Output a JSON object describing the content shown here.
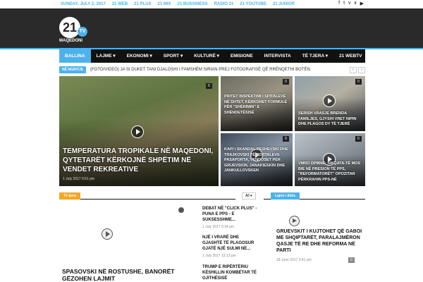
{
  "topbar": {
    "date": "SUNDAY, JULY 2, 2017",
    "links": [
      "21 WEB",
      "21 PLUS",
      "21 MIX",
      "21 BUSSINESS",
      "RADIO 21",
      "21 YOUTUBE",
      "21 JUNIOR"
    ],
    "social_icons": [
      "facebook-icon",
      "twitter-icon",
      "vimeo-icon",
      "vk-icon",
      "youtube-icon"
    ]
  },
  "logo": {
    "number": "21",
    "tv": "TV",
    "sub": "MAQEDONI"
  },
  "nav": {
    "items": [
      "BALLINA",
      "LAJME ▾",
      "EKONOMI ▾",
      "SPORT ▾",
      "KULTURË ▾",
      "EMISIONE",
      "INTERVISTA",
      "TË TJERA ▾",
      "21 WEBTV"
    ],
    "search_icon": "search-icon"
  },
  "ticker": {
    "badge": "NË NGRITJE",
    "text": "(FOTO/VIDEO) JA SI DUKET TANI DJALOSHI I FAMSHËM SIRIAN PREJ FOTOGRAFISË QË RRËNQETHI BOTËN",
    "prev": "‹",
    "next": "›"
  },
  "featured": {
    "main": {
      "title": "TEMPERATURA TROPIKALE NË MAQEDONI, QYTETARËT KËRKOJNË SHPËTIM NË VENDET REKREATIVE",
      "date": "1 July 2017 6:51 pm",
      "comments": "0"
    },
    "tiles": [
      {
        "title": "PRITET INSPEKTIMI I SPITALEVE NË SHTET, KËRKOHET FORMULË PËR \"SHËRIMIN\" E SHËNDETËSISË",
        "comments": "0"
      },
      {
        "title": "SERISH VRASJE BRENDA FAMILJES, GJYSHI VRET NIPIN DHE PLAGOS DY TË TJERË",
        "comments": "0"
      },
      {
        "title": "KAPI I SKANDAL PESHEVSKI DHE TRAJKOVSKI TË PORTALEVE PASAPORTA, VENDOSET PËR GRUEVSKIN, JANAKIESKIN DHE JANKULLOVSKEN",
        "comments": "0"
      },
      {
        "title": "VMRO DPMNE: SIKQATA-TË MOS BIE NË PRESION TË PPS, \"REFORMATORËT\" OPOZITAR PËRKRAHIN PPS-NË",
        "comments": "0"
      }
    ]
  },
  "left_section": {
    "tag": "Të tjera",
    "filter": "All ▾",
    "main_title": "SPASOVSKI NË ROSTUSHE, BANORËT I GËZOHEN LAJMIT"
  },
  "mid_list": [
    {
      "title": "DEBAT NË \"CLICK PLUS\" - PUNA E PPS - E SUKSESSHME...",
      "date": "1 July 2017 5:34 pm"
    },
    {
      "title": "NJË I VRARË DHE GJASHTË TË PLAGOSUR GJATË NJË SULMI NË...",
      "date": "1 July 2017 12:13 pm"
    },
    {
      "title": "TRUMP E RIPËRTËRIU KËSHILLIN KOMBËTAR TË GJITHËSISË",
      "date": ""
    }
  ],
  "right_section": {
    "tag": "Lajmi i ditës",
    "title": "GRUEVSKIT I KUJTOHET QË GABOI ME SHQIPTARËT, PARALAJMËRON QASJE TË RE DHE REFORMA NË PARTI",
    "date": "18 June 2017 5:41 pm",
    "comments": "0"
  },
  "colors": {
    "accent": "#4db2ec",
    "header": "#2a2a2a",
    "nav": "#111111",
    "tag_orange": "#f5a623"
  }
}
